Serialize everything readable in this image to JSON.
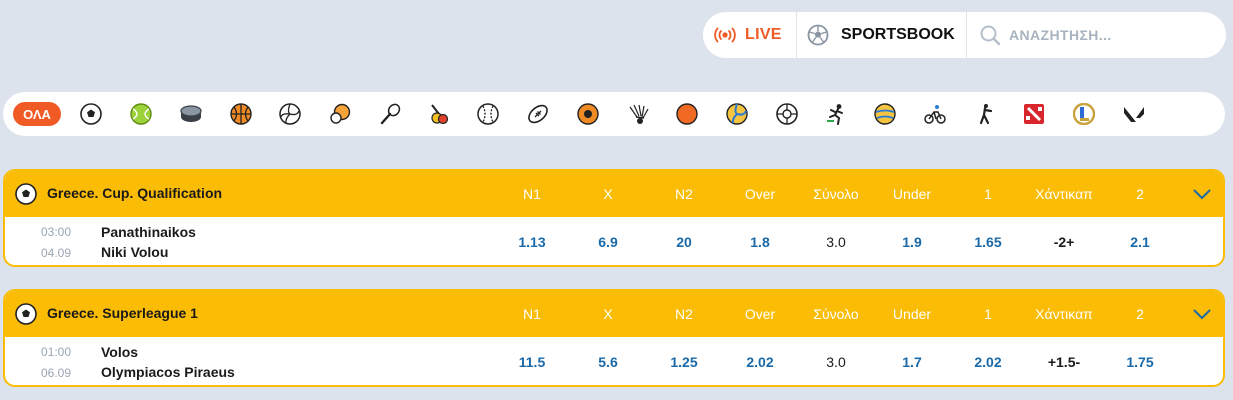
{
  "topnav": {
    "live_label": "LIVE",
    "sportsbook_label": "SPORTSBOOK",
    "search_placeholder": "ΑΝΑΖΗΤΗΣΗ..."
  },
  "filter": {
    "all_label": "ΟΛΑ",
    "sports": [
      "football",
      "tennis",
      "ice-hockey",
      "basketball",
      "volleyball",
      "table-tennis",
      "badminton",
      "snooker",
      "baseball",
      "american-football",
      "handball",
      "badminton-shuttle",
      "basketball-alt",
      "beach-volleyball",
      "futsal",
      "athletics",
      "volleyball-alt",
      "cycling",
      "counter-strike",
      "dota-2",
      "league-of-legends",
      "valorant"
    ]
  },
  "colors": {
    "accent": "#f05a24",
    "league_header": "#fbbc05",
    "odds": "#1a69a8",
    "background": "#dce3ec"
  },
  "leagues": [
    {
      "name": "Greece. Cup. Qualification",
      "columns": [
        "N1",
        "X",
        "N2",
        "Over",
        "Σύνολο",
        "Under",
        "1",
        "Χάντικαπ",
        "2"
      ],
      "match": {
        "time": "03:00",
        "date": "04.09",
        "home": "Panathinaikos",
        "away": "Niki Volou",
        "odds": [
          "1.13",
          "6.9",
          "20",
          "1.8",
          "3.0",
          "1.9",
          "1.65",
          "-2+",
          "2.1"
        ]
      }
    },
    {
      "name": "Greece. Superleague 1",
      "columns": [
        "N1",
        "X",
        "N2",
        "Over",
        "Σύνολο",
        "Under",
        "1",
        "Χάντικαπ",
        "2"
      ],
      "match": {
        "time": "01:00",
        "date": "06.09",
        "home": "Volos",
        "away": "Olympiacos Piraeus",
        "odds": [
          "11.5",
          "5.6",
          "1.25",
          "2.02",
          "3.0",
          "1.7",
          "2.02",
          "+1.5-",
          "1.75"
        ]
      }
    }
  ]
}
